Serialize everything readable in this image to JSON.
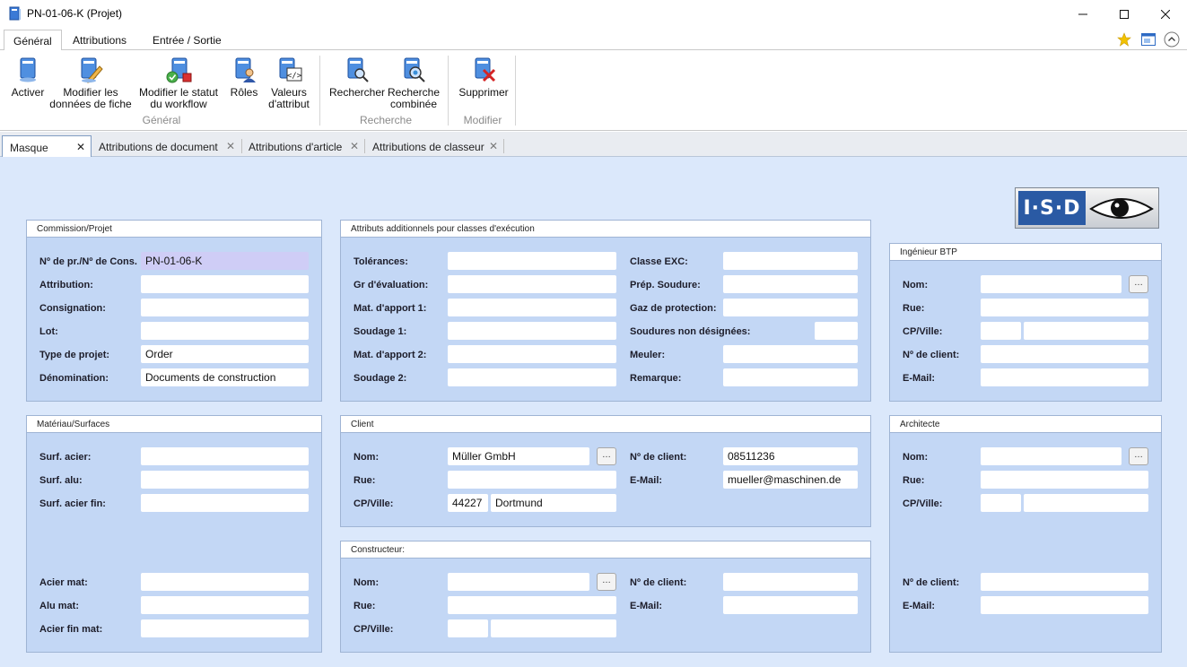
{
  "window": {
    "title": "PN-01-06-K (Projet)"
  },
  "ribbon_tabs": [
    "Général",
    "Attributions",
    "Entrée / Sortie"
  ],
  "ribbon": {
    "buttons": [
      {
        "label": "Activer",
        "icon": "activate-icon"
      },
      {
        "label": "Modifier les données de fiche",
        "icon": "edit-form-icon"
      },
      {
        "label": "Modifier le statut du workflow",
        "icon": "workflow-icon"
      },
      {
        "label": "Rôles",
        "icon": "roles-icon"
      },
      {
        "label": "Valeurs d'attribut",
        "icon": "attribute-values-icon"
      },
      {
        "label": "Rechercher",
        "icon": "search-icon"
      },
      {
        "label": "Recherche combinée",
        "icon": "combined-search-icon"
      },
      {
        "label": "Supprimer",
        "icon": "delete-icon"
      }
    ],
    "groups": [
      "Général",
      "Recherche",
      "Modifier"
    ]
  },
  "doc_tabs": [
    "Masque",
    "Attributions de document",
    "Attributions d'article",
    "Attributions de classeur"
  ],
  "panels": {
    "commission": {
      "title": "Commission/Projet",
      "labels": [
        "Nº de pr./Nº de Cons.",
        "Attribution:",
        "Consignation:",
        "Lot:",
        "Type de projet:",
        "Dénomination:"
      ],
      "values": [
        "PN-01-06-K",
        "",
        "",
        "",
        "Order",
        "Documents de construction"
      ]
    },
    "attributs": {
      "title": "Attributs additionnels pour classes d'exécution",
      "left_labels": [
        "Tolérances:",
        "Gr d'évaluation:",
        "Mat. d'apport 1:",
        "Soudage 1:",
        "Mat. d'apport 2:",
        "Soudage 2:"
      ],
      "right_labels": [
        "Classe EXC:",
        "Prép. Soudure:",
        "Gaz de protection:",
        "Soudures non désignées:",
        "Meuler:",
        "Remarque:"
      ]
    },
    "ingenieur": {
      "title": "Ingénieur BTP",
      "labels": [
        "Nom:",
        "Rue:",
        "CP/Ville:",
        "Nº de client:",
        "E-Mail:"
      ]
    },
    "materiau": {
      "title": "Matériau/Surfaces",
      "labels": [
        "Surf. acier:",
        "Surf. alu:",
        "Surf. acier fin:",
        "Acier mat:",
        "Alu mat:",
        "Acier fin mat:"
      ]
    },
    "client": {
      "title": "Client",
      "labels": [
        "Nom:",
        "Rue:",
        "CP/Ville:",
        "Nº de client:",
        "E-Mail:"
      ],
      "values": {
        "nom": "Müller GmbH",
        "cp": "44227",
        "ville": "Dortmund",
        "client_no": "08511236",
        "email": "mueller@maschinen.de"
      }
    },
    "architecte": {
      "title": "Architecte",
      "labels": [
        "Nom:",
        "Rue:",
        "CP/Ville:",
        "Nº de client:",
        "E-Mail:"
      ]
    },
    "constructeur": {
      "title": "Constructeur:",
      "labels": [
        "Nom:",
        "Rue:",
        "CP/Ville:",
        "Nº de client:",
        "E-Mail:"
      ]
    }
  },
  "logo": {
    "text": "I·S·D"
  },
  "colors": {
    "panel": "#c3d7f5",
    "background": "#dbe8fb",
    "highlight_field": "#cfcdf6",
    "logo_blue": "#2a5aa4"
  }
}
